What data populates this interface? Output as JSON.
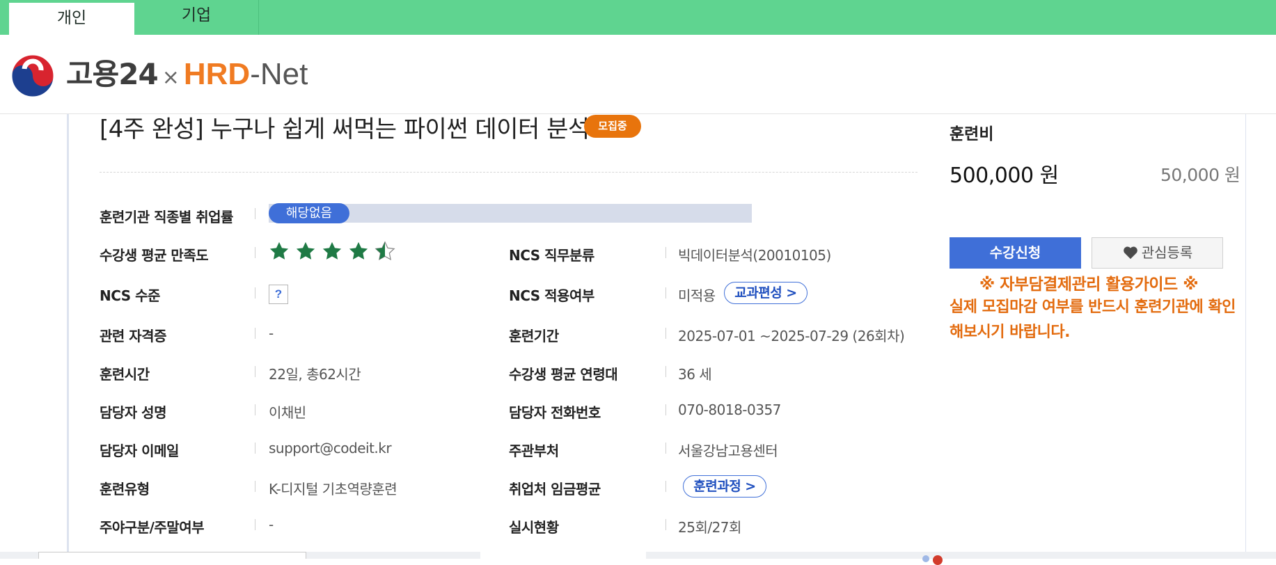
{
  "tabs": [
    {
      "label": "개인",
      "active": true
    },
    {
      "label": "기업",
      "active": false
    }
  ],
  "logo": {
    "goyong": "고용24",
    "x": "×",
    "hrd": "HRD",
    "net": "-Net"
  },
  "course": {
    "title": "[4주 완성] 누구나 쉽게 써먹는 파이썬 데이터 분석",
    "status_badge": "모집중"
  },
  "info": {
    "employment_rate": {
      "label": "훈련기관 직종별 취업률",
      "value": "해당없음"
    },
    "satisfaction": {
      "label": "수강생 평균 만족도",
      "stars_filled": 4.5,
      "stars_total": 5
    },
    "ncs_class": {
      "label": "NCS 직무분류",
      "value": "빅데이터분석(20010105)"
    },
    "ncs_level": {
      "label": "NCS 수준",
      "value": "?"
    },
    "ncs_applied": {
      "label": "NCS 적용여부",
      "value": "미적용",
      "button": "교과편성 >"
    },
    "certificate": {
      "label": "관련 자격증",
      "value": "-"
    },
    "period": {
      "label": "훈련기간",
      "value": "2025-07-01 ~2025-07-29 (26회차)"
    },
    "hours": {
      "label": "훈련시간",
      "value": "22일, 총62시간"
    },
    "avg_age": {
      "label": "수강생 평균 연령대",
      "value": "36 세"
    },
    "manager": {
      "label": "담당자 성명",
      "value": "이채빈"
    },
    "phone": {
      "label": "담당자 전화번호",
      "value": "070-8018-0357"
    },
    "email": {
      "label": "담당자 이메일",
      "value": "support@codeit.kr"
    },
    "ministry": {
      "label": "주관부처",
      "value": "서울강남고용센터"
    },
    "type": {
      "label": "훈련유형",
      "value": "K-디지털 기초역량훈련"
    },
    "wage": {
      "label": "취업처 임금평균",
      "button": "훈련과정 >"
    },
    "day_night": {
      "label": "주야구분/주말여부",
      "value": "-"
    },
    "progress": {
      "label": "실시현황",
      "value": "25회/27회"
    }
  },
  "fee": {
    "label": "훈련비",
    "main": "500,000 원",
    "sub": "50,000 원"
  },
  "actions": {
    "apply": "수강신청",
    "favorite": "관심등록"
  },
  "guide": {
    "title": "※ 자부담결제관리 활용가이드 ※",
    "body": "실제 모집마감 여부를 반드시 훈련기관에 확인해보시기 바랍니다."
  },
  "colors": {
    "topbar": "#5fd490",
    "primary": "#3f6fd8",
    "accent_orange": "#e8740c",
    "star_green": "#1f7a45"
  }
}
